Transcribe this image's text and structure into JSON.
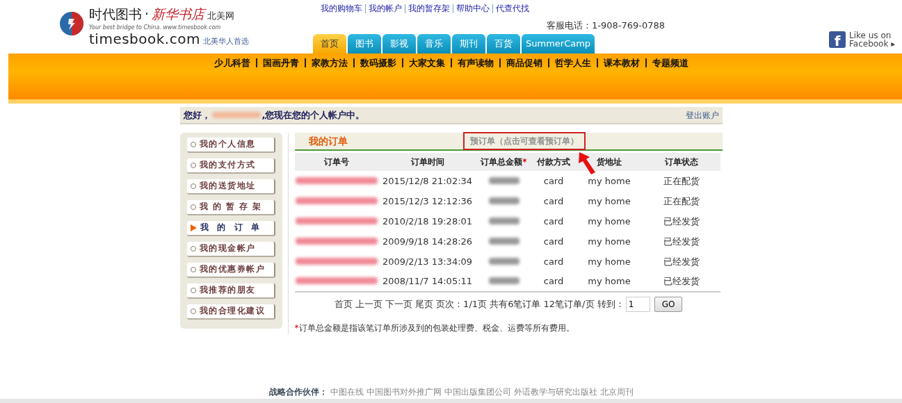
{
  "logo": {
    "name_cn": "时代图书",
    "dot": "·",
    "name_brand": "新华书店",
    "name_suffix": "北美网",
    "tagline": "Your best bridge to China. www.timesbook.com",
    "domain": "timesbook.com",
    "slogan": "北美华人首选"
  },
  "top_links": [
    "我的购物车",
    "我的帐户",
    "我的暂存架",
    "帮助中心",
    "代查代找"
  ],
  "phone": "客服电话：1-908-769-0788",
  "facebook": {
    "logo_letter": "f",
    "line1": "Like us on",
    "line2": "Facebook ▸"
  },
  "tabs": [
    {
      "label": "首页",
      "selected": true
    },
    {
      "label": "图书",
      "selected": false
    },
    {
      "label": "影视",
      "selected": false
    },
    {
      "label": "音乐",
      "selected": false
    },
    {
      "label": "期刊",
      "selected": false
    },
    {
      "label": "百货",
      "selected": false
    },
    {
      "label": "SummerCamp",
      "selected": false
    }
  ],
  "categories": [
    "少儿科普",
    "国画丹青",
    "家教方法",
    "数码摄影",
    "大家文集",
    "有声读物",
    "商品促销",
    "哲学人生",
    "课本教材",
    "专题频道"
  ],
  "greeting": {
    "prefix": "您好，",
    "name_redacted": true,
    "suffix": ",您现在您的个人帐户中。",
    "logout": "登出账户"
  },
  "sidebar": {
    "items": [
      {
        "label": "我的个人信息",
        "selected": false
      },
      {
        "label": "我的支付方式",
        "selected": false
      },
      {
        "label": "我的送货地址",
        "selected": false
      },
      {
        "label": "我 的 暂 存 架",
        "selected": false
      },
      {
        "label": "我  的  订  单",
        "selected": true
      },
      {
        "label": "我的现金帐户",
        "selected": false
      },
      {
        "label": "我的优惠券帐户",
        "selected": false
      },
      {
        "label": "我推荐的朋友",
        "selected": false
      },
      {
        "label": "我的合理化建议",
        "selected": false
      }
    ]
  },
  "orders": {
    "title": "我的订单",
    "preorder_link": "预订单（点击可查看预订单）",
    "columns": [
      {
        "label": "订单号"
      },
      {
        "label": "订单时间"
      },
      {
        "label": "订单总金额",
        "mark": "*"
      },
      {
        "label": "付款方式"
      },
      {
        "label": "货地址"
      },
      {
        "label": "订单状态"
      }
    ],
    "rows": [
      {
        "number_redacted": true,
        "time": "2015/12/8 21:02:34",
        "amount_redacted": true,
        "payment": "card",
        "address": "my home",
        "status": "正在配货"
      },
      {
        "number_redacted": true,
        "time": "2015/12/3 12:12:36",
        "amount_redacted": true,
        "payment": "card",
        "address": "my home",
        "status": "正在配货"
      },
      {
        "number_redacted": true,
        "time": "2010/2/18 19:28:01",
        "amount_redacted": true,
        "payment": "card",
        "address": "my home",
        "status": "已经发货"
      },
      {
        "number_redacted": true,
        "time": "2009/9/18 14:28:26",
        "amount_redacted": true,
        "payment": "card",
        "address": "my home",
        "status": "已经发货"
      },
      {
        "number_redacted": true,
        "time": "2009/2/13 13:34:09",
        "amount_redacted": true,
        "payment": "card",
        "address": "my home",
        "status": "已经发货"
      },
      {
        "number_redacted": true,
        "time": "2008/11/7 14:05:11",
        "amount_redacted": true,
        "payment": "card",
        "address": "my home",
        "status": "已经发货"
      }
    ],
    "pager": {
      "text": "首页 上一页 下一页 尾页 页次：1/1页 共有6笔订单 12笔订单/页 转到：",
      "page_value": "1",
      "go": "GO"
    },
    "footnote": {
      "mark": "*",
      "text": "订单总金额是指该笔订单所涉及到的包装处理费、税金、运费等所有费用。"
    }
  },
  "footer": {
    "label": "战略合作伙伴：",
    "partners": [
      "中图在线",
      "中国图书对外推广网",
      "中国出版集团公司",
      "外语教学与研究出版社",
      "北京周刊"
    ]
  }
}
